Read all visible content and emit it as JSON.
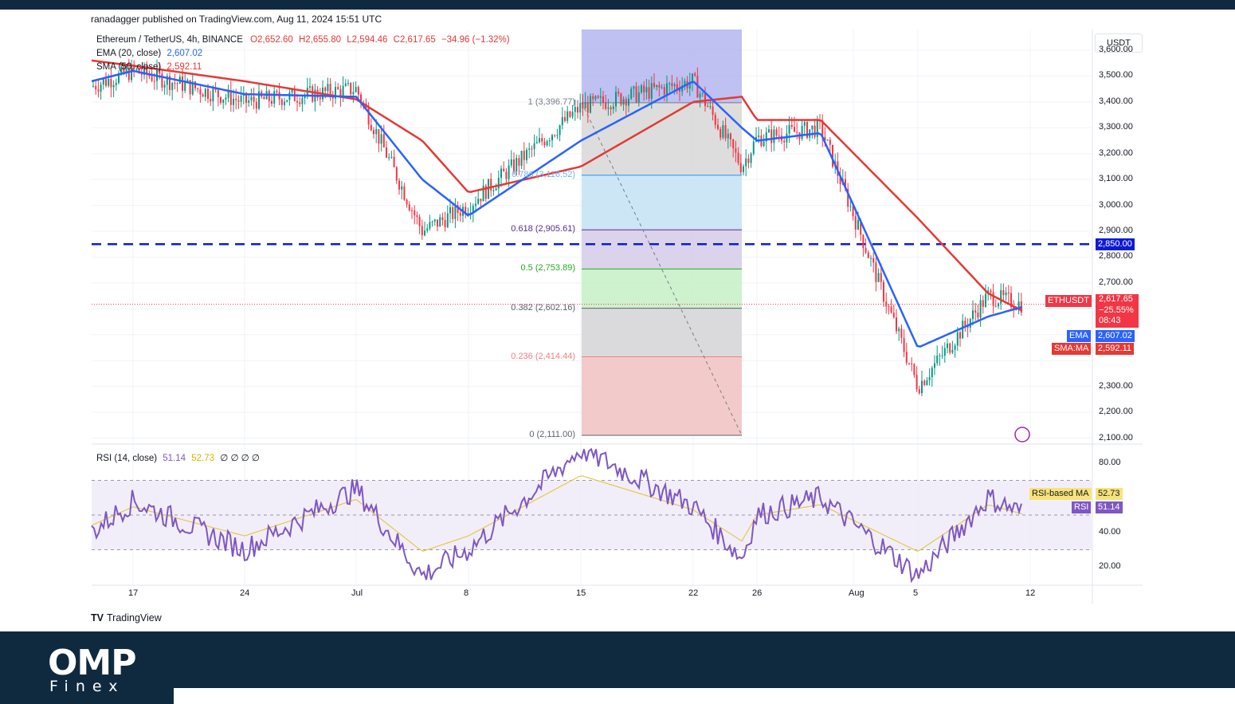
{
  "header": {
    "published": "ranadagger published on TradingView.com, Aug 11, 2024 15:51 UTC",
    "symbol": "Ethereum / TetherUS, 4h, BINANCE",
    "ohlc": {
      "o": "O2,652.60",
      "h": "H2,655.80",
      "l": "L2,594.46",
      "c": "C2,617.65",
      "chg": "−34.96 (−1.32%)"
    },
    "ema_label": "EMA (20, close)",
    "ema_value": "2,607.02",
    "sma_label": "SMA (50, close)",
    "sma_value": "2,592.11",
    "rsi_label": "RSI (14, close)",
    "rsi_value": "51.14",
    "rsi_ma_value": "52.73",
    "rsi_extra": "∅ ∅ ∅ ∅"
  },
  "price_axis": {
    "currency": "USDT",
    "ticks": [
      "3,600.00",
      "3,500.00",
      "3,400.00",
      "3,300.00",
      "3,200.00",
      "3,100.00",
      "3,000.00",
      "2,900.00",
      "2,800.00",
      "2,700.00",
      "2,300.00",
      "2,200.00",
      "2,100.00"
    ]
  },
  "rsi_axis": {
    "ticks": [
      "80.00",
      "40.00",
      "20.00"
    ]
  },
  "time_axis": {
    "ticks": [
      "17",
      "24",
      "Jul",
      "8",
      "15",
      "22",
      "26",
      "Aug",
      "5",
      "12"
    ]
  },
  "labels": {
    "level": "2,850.00",
    "ethusdt_tag": "ETHUSDT",
    "last_price": "2,617.65",
    "last_change": "−25.55%",
    "countdown": "08:43",
    "ema_tag": "EMA",
    "ema_price": "2,607.02",
    "sma_tag": "SMA:MA",
    "sma_price": "2,592.11",
    "rsi_ma_tag": "RSI-based MA",
    "rsi_ma_val": "52.73",
    "rsi_tag": "RSI",
    "rsi_val": "51.14"
  },
  "fib_labels": [
    {
      "text": "1 (3,396.77)",
      "color": "#787b86"
    },
    {
      "text": "0.786 (3,116.52)",
      "color": "#64b5f6"
    },
    {
      "text": "0.618 (2,905.61)",
      "color": "#5b2c8f"
    },
    {
      "text": "0.5 (2,753.89)",
      "color": "#22ab22"
    },
    {
      "text": "0.382 (2,602.16)",
      "color": "#5d606b"
    },
    {
      "text": "0.236 (2,414.44)",
      "color": "#f08080"
    },
    {
      "text": "0 (2,111.00)",
      "color": "#5d606b"
    }
  ],
  "footer": {
    "brand": "TradingView"
  },
  "branding": {
    "name": "OMP",
    "sub": "Finex"
  },
  "colors": {
    "ema": "#2962ff",
    "sma": "#e53935",
    "rsi": "#7e57c2",
    "rsi_ma": "#e6c84a",
    "level": "#0d1bd4",
    "up": "#089981",
    "down": "#f23645"
  },
  "chart_data": {
    "type": "candlestick",
    "symbol": "ETH/USDT",
    "timeframe": "4h",
    "x": [
      "Jun 14",
      "Jun 17",
      "Jun 24",
      "Jul 1",
      "Jul 5",
      "Jul 8",
      "Jul 15",
      "Jul 22",
      "Jul 25",
      "Jul 26",
      "Aug 1",
      "Aug 5",
      "Aug 9",
      "Aug 11"
    ],
    "close": [
      3460,
      3520,
      3400,
      3450,
      2900,
      3000,
      3380,
      3480,
      3150,
      3260,
      3300,
      2300,
      2650,
      2617.65
    ],
    "ema20": [
      3480,
      3520,
      3430,
      3420,
      3100,
      2960,
      3250,
      3480,
      3300,
      3250,
      3280,
      2450,
      2570,
      2607.02
    ],
    "sma50": [
      3560,
      3540,
      3480,
      3410,
      3250,
      3050,
      3150,
      3400,
      3420,
      3330,
      3330,
      2950,
      2660,
      2592.11
    ],
    "rsi": [
      40,
      58,
      30,
      65,
      15,
      30,
      88,
      55,
      25,
      50,
      60,
      15,
      60,
      51.14
    ],
    "horizontal_level": 2850,
    "fibonacci": [
      {
        "ratio": 1,
        "price": 3396.77
      },
      {
        "ratio": 0.786,
        "price": 3116.52
      },
      {
        "ratio": 0.618,
        "price": 2905.61
      },
      {
        "ratio": 0.5,
        "price": 2753.89
      },
      {
        "ratio": 0.382,
        "price": 2602.16
      },
      {
        "ratio": 0.236,
        "price": 2414.44
      },
      {
        "ratio": 0,
        "price": 2111.0
      }
    ],
    "ylim": [
      2080,
      3680
    ],
    "rsi_ylim": [
      10,
      90
    ]
  }
}
